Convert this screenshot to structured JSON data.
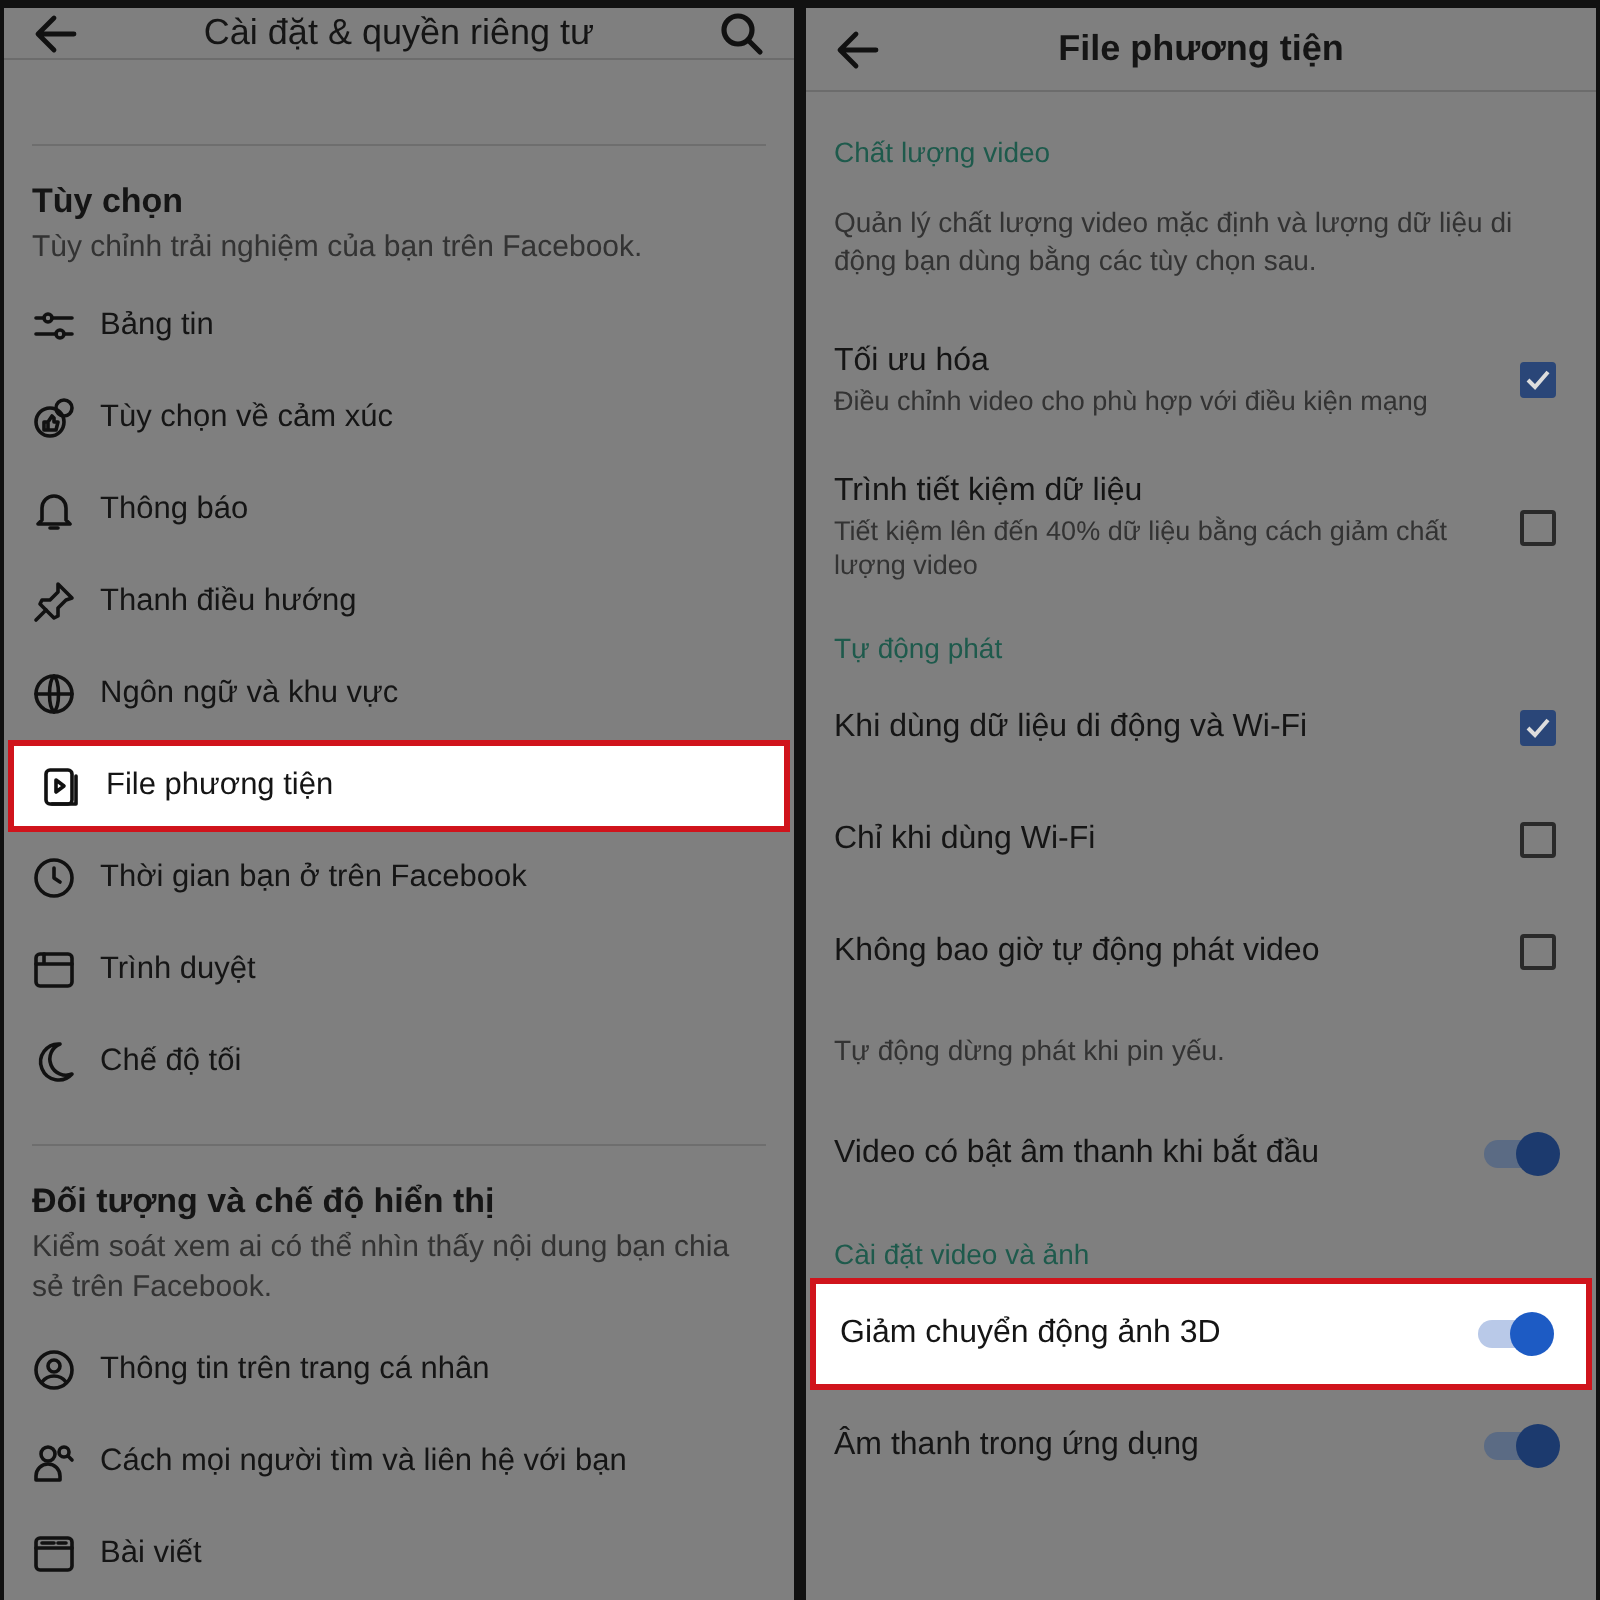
{
  "left_screen": {
    "title": "Cài đặt & quyền riêng tư",
    "sections": [
      {
        "title": "Tùy chọn",
        "subtitle": "Tùy chỉnh trải nghiệm của bạn trên Facebook.",
        "items": [
          {
            "label": "Bảng tin",
            "highlighted": false
          },
          {
            "label": "Tùy chọn về cảm xúc",
            "highlighted": false
          },
          {
            "label": "Thông báo",
            "highlighted": false
          },
          {
            "label": "Thanh điều hướng",
            "highlighted": false
          },
          {
            "label": "Ngôn ngữ và khu vực",
            "highlighted": false
          },
          {
            "label": "File phương tiện",
            "highlighted": true
          },
          {
            "label": "Thời gian bạn ở trên Facebook",
            "highlighted": false
          },
          {
            "label": "Trình duyệt",
            "highlighted": false
          },
          {
            "label": "Chế độ tối",
            "highlighted": false
          }
        ]
      },
      {
        "title": "Đối tượng và chế độ hiển thị",
        "subtitle": "Kiểm soát xem ai có thể nhìn thấy nội dung bạn chia sẻ trên Facebook.",
        "items": [
          {
            "label": "Thông tin trên trang cá nhân",
            "highlighted": false
          },
          {
            "label": "Cách mọi người tìm và liên hệ với bạn",
            "highlighted": false
          },
          {
            "label": "Bài viết",
            "highlighted": false
          }
        ]
      }
    ]
  },
  "right_screen": {
    "title": "File phương tiện",
    "sections": [
      {
        "title": "Chất lượng video",
        "items": [
          {
            "kind": "note",
            "label": "Quản lý chất lượng video mặc định và lượng dữ liệu di động bạn dùng bằng các tùy chọn sau."
          },
          {
            "kind": "checkbox",
            "label": "Tối ưu hóa",
            "sublabel": "Điều chỉnh video cho phù hợp với điều kiện mạng",
            "checked": true,
            "highlighted": false
          },
          {
            "kind": "checkbox",
            "label": "Trình tiết kiệm dữ liệu",
            "sublabel": "Tiết kiệm lên đến 40% dữ liệu bằng cách giảm chất lượng video",
            "checked": false,
            "highlighted": false
          }
        ]
      },
      {
        "title": "Tự động phát",
        "items": [
          {
            "kind": "checkbox",
            "label": "Khi dùng dữ liệu di động và Wi-Fi",
            "checked": true,
            "highlighted": false
          },
          {
            "kind": "checkbox",
            "label": "Chỉ khi dùng Wi-Fi",
            "checked": false,
            "highlighted": false
          },
          {
            "kind": "checkbox",
            "label": "Không bao giờ tự động phát video",
            "checked": false,
            "highlighted": false
          },
          {
            "kind": "note",
            "label": "Tự động dừng phát khi pin yếu."
          },
          {
            "kind": "switch",
            "label": "Video có bật âm thanh khi bắt đầu",
            "on": true,
            "highlighted": false
          }
        ]
      },
      {
        "title": "Cài đặt video và ảnh",
        "items": [
          {
            "kind": "switch",
            "label": "Giảm chuyển động ảnh 3D",
            "on": true,
            "highlighted": true
          },
          {
            "kind": "switch",
            "label": "Âm thanh trong ứng dụng",
            "on": true,
            "highlighted": false
          }
        ]
      }
    ]
  }
}
